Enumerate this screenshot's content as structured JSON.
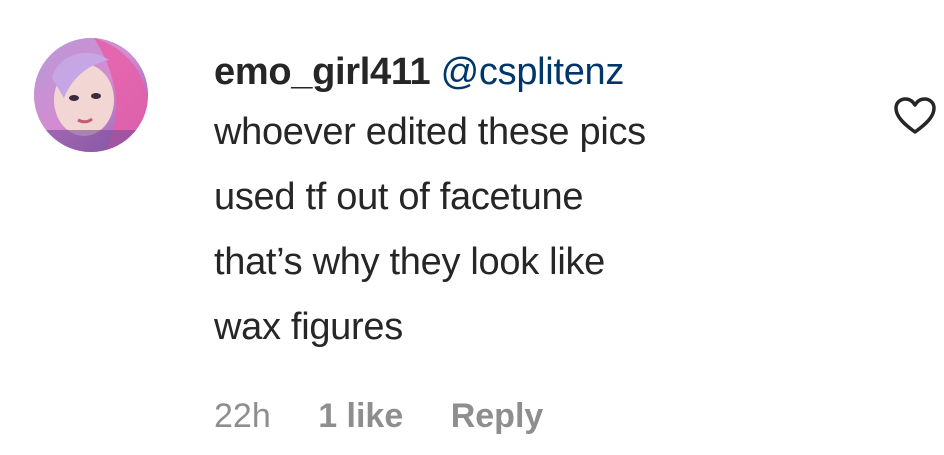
{
  "comment": {
    "username": "emo_girl411",
    "mention": "@csplitenz",
    "text_lines": [
      "whoever edited these pics",
      "used tf out of facetune",
      "that’s why they look like",
      "wax figures"
    ],
    "time": "22h",
    "likes": "1 like",
    "reply_label": "Reply",
    "like_icon": "heart-outline-icon"
  },
  "colors": {
    "text": "#262626",
    "mention": "#00376b",
    "meta": "#8e8e8e"
  }
}
